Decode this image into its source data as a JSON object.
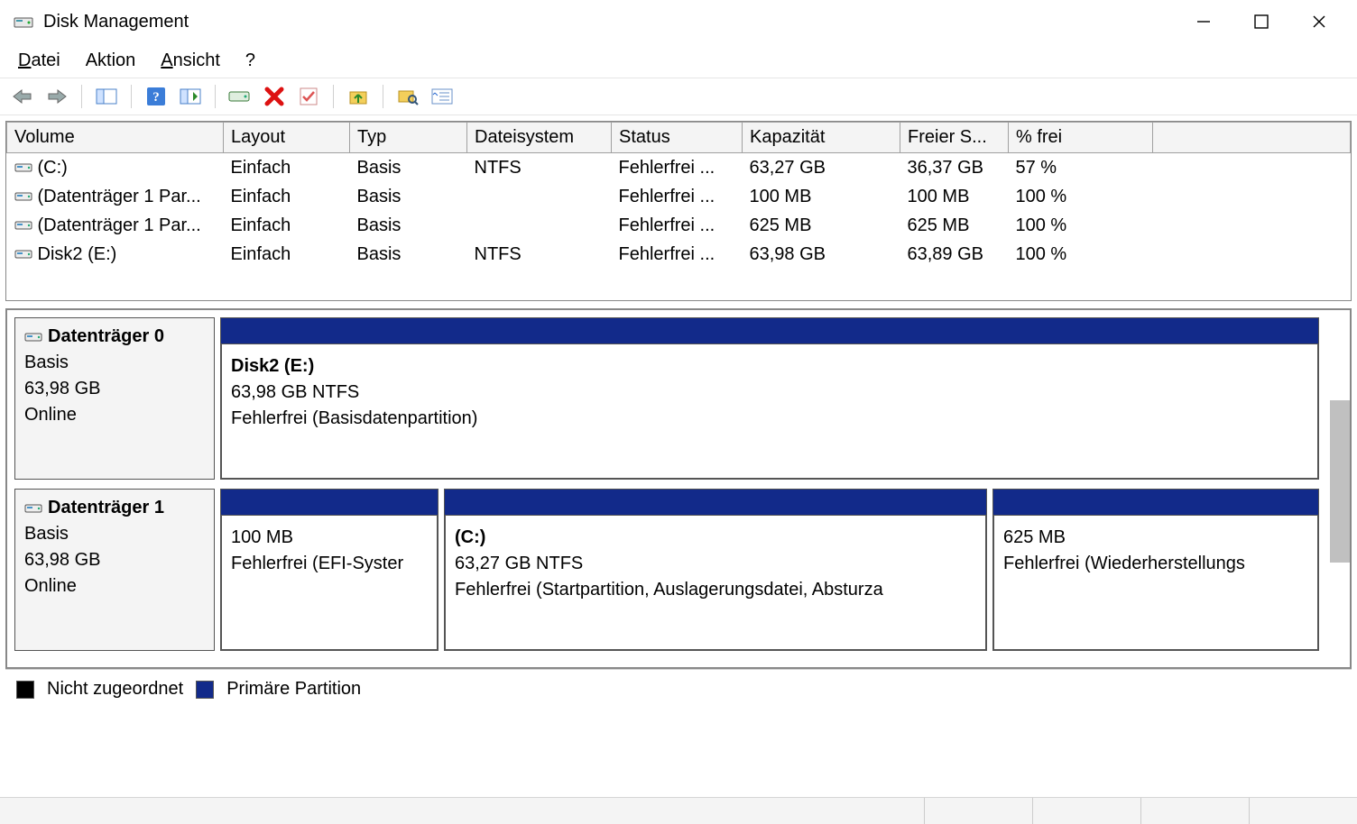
{
  "window": {
    "title": "Disk Management"
  },
  "menu": {
    "datei": "Datei",
    "aktion": "Aktion",
    "ansicht": "Ansicht",
    "help": "?"
  },
  "columns": {
    "volume": "Volume",
    "layout": "Layout",
    "typ": "Typ",
    "fs": "Dateisystem",
    "status": "Status",
    "cap": "Kapazität",
    "free": "Freier S...",
    "pct": "% frei"
  },
  "volumes": [
    {
      "name": " (C:)",
      "layout": "Einfach",
      "typ": "Basis",
      "fs": "NTFS",
      "status": "Fehlerfrei ...",
      "cap": "63,27 GB",
      "free": "36,37 GB",
      "pct": "57 %"
    },
    {
      "name": "(Datenträger 1 Par...",
      "layout": "Einfach",
      "typ": "Basis",
      "fs": "",
      "status": "Fehlerfrei ...",
      "cap": "100 MB",
      "free": "100 MB",
      "pct": "100 %"
    },
    {
      "name": "(Datenträger 1 Par...",
      "layout": "Einfach",
      "typ": "Basis",
      "fs": "",
      "status": "Fehlerfrei ...",
      "cap": "625 MB",
      "free": "625 MB",
      "pct": "100 %"
    },
    {
      "name": "Disk2 (E:)",
      "layout": "Einfach",
      "typ": "Basis",
      "fs": "NTFS",
      "status": "Fehlerfrei ...",
      "cap": "63,98 GB",
      "free": "63,89 GB",
      "pct": "100 %"
    }
  ],
  "disks": [
    {
      "title": "Datenträger 0",
      "type": "Basis",
      "size": "63,98 GB",
      "state": "Online",
      "parts": [
        {
          "title": "Disk2  (E:)",
          "line2": "63,98 GB NTFS",
          "line3": "Fehlerfrei (Basisdatenpartition)",
          "flex": 1
        }
      ]
    },
    {
      "title": "Datenträger 1",
      "type": "Basis",
      "size": "63,98 GB",
      "state": "Online",
      "parts": [
        {
          "title": "",
          "line2": "100 MB",
          "line3": "Fehlerfrei (EFI-Syster",
          "flex": 0.2
        },
        {
          "title": " (C:)",
          "line2": "63,27 GB NTFS",
          "line3": "Fehlerfrei (Startpartition, Auslagerungsdatei, Absturza",
          "flex": 0.5
        },
        {
          "title": "",
          "line2": "625 MB",
          "line3": "Fehlerfrei (Wiederherstellungs",
          "flex": 0.3
        }
      ]
    }
  ],
  "legend": {
    "unallocated": "Nicht zugeordnet",
    "primary": "Primäre Partition"
  }
}
